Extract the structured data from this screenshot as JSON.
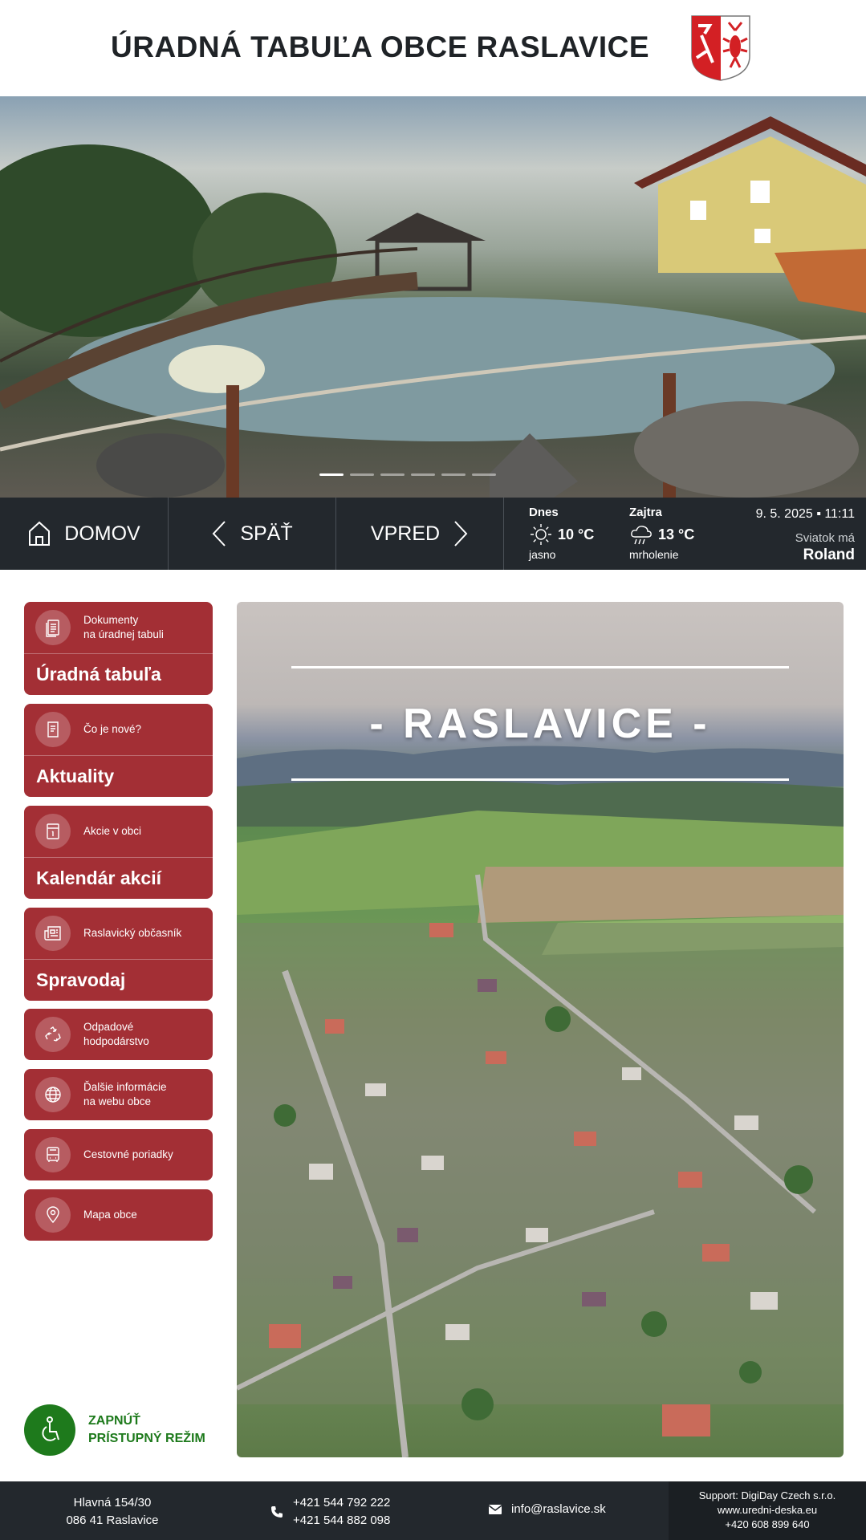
{
  "header": {
    "title": "ÚRADNÁ TABUĽA OBCE RASLAVICE"
  },
  "hero": {
    "slides_total": 6,
    "active_slide": 1
  },
  "navbar": {
    "home_label": "DOMOV",
    "back_label": "SPÄŤ",
    "forward_label": "VPRED",
    "weather_today": {
      "day": "Dnes",
      "temp": "10 °C",
      "desc": "jasno",
      "icon": "sun-icon"
    },
    "weather_tomorrow": {
      "day": "Zajtra",
      "temp": "13 °C",
      "desc": "mrholenie",
      "icon": "rain-cloud-icon"
    },
    "date": "9. 5. 2025 ▪ 11:11",
    "holiday_label": "Sviatok má",
    "holiday_name": "Roland"
  },
  "sidebar": {
    "items": [
      {
        "small": "Dokumenty\nna úradnej tabuli",
        "big": "Úradná tabuľa",
        "icon": "document-icon"
      },
      {
        "small": "Čo je nové?",
        "big": "Aktuality",
        "icon": "news-icon"
      },
      {
        "small": "Akcie v obci",
        "big": "Kalendár akcií",
        "icon": "calendar-icon"
      },
      {
        "small": "Raslavický občasník",
        "big": "Spravodaj",
        "icon": "newspaper-icon"
      },
      {
        "small": "Odpadové\nhodpodárstvo",
        "big": "",
        "icon": "recycle-icon"
      },
      {
        "small": "Ďalšie informácie\nna webu obce",
        "big": "",
        "icon": "globe-icon"
      },
      {
        "small": "Cestovné poriadky",
        "big": "",
        "icon": "bus-icon"
      },
      {
        "small": "Mapa obce",
        "big": "",
        "icon": "map-pin-icon"
      }
    ]
  },
  "main": {
    "title": "- RASLAVICE -"
  },
  "accessibility": {
    "line1": "ZAPNÚŤ",
    "line2": "PRÍSTUPNÝ REŽIM"
  },
  "footer": {
    "address_line1": "Hlavná 154/30",
    "address_line2": "086 41 Raslavice",
    "phone1": "+421 544 792 222",
    "phone2": "+421 544 882 098",
    "email": "info@raslavice.sk",
    "support_line1": "Support: DigiDay Czech s.r.o.",
    "support_line2": "www.uredni-deska.eu",
    "support_line3": "+420 608 899 640"
  },
  "colors": {
    "accent_red": "#a32f35",
    "dark_bar": "#23282d",
    "access_green": "#1e7a1c"
  }
}
